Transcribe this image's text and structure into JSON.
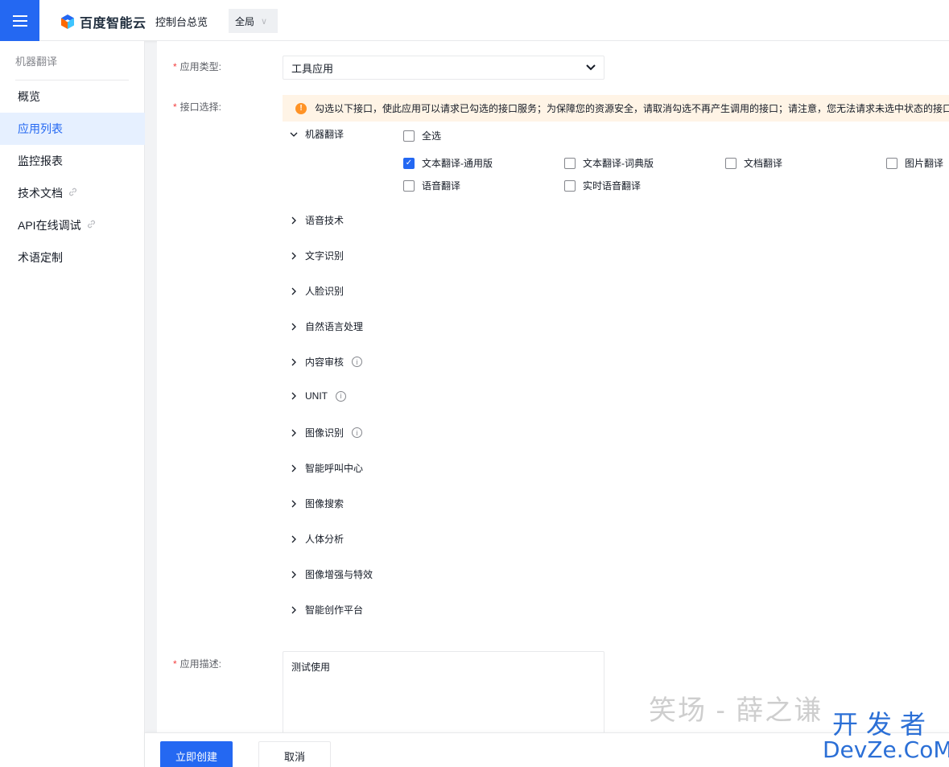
{
  "topbar": {
    "brand": "百度智能云",
    "console": "控制台总览",
    "region": "全局"
  },
  "sidebar": {
    "title": "机器翻译",
    "items": [
      {
        "label": "概览",
        "name": "sidebar-item-overview"
      },
      {
        "label": "应用列表",
        "name": "sidebar-item-app-list",
        "active": true
      },
      {
        "label": "监控报表",
        "name": "sidebar-item-monitor-report"
      },
      {
        "label": "技术文档",
        "name": "sidebar-item-tech-docs",
        "external": true
      },
      {
        "label": "API在线调试",
        "name": "sidebar-item-api-debug",
        "external": true
      },
      {
        "label": "术语定制",
        "name": "sidebar-item-term-custom"
      }
    ]
  },
  "form": {
    "app_type_label": "应用类型:",
    "app_type_value": "工具应用",
    "interface_label": "接口选择:",
    "notice": "勾选以下接口，使此应用可以请求已勾选的接口服务；为保障您的资源安全，请取消勾选不再产生调用的接口；请注意，您无法请求未选中状态的接口服务",
    "expanded_group": "机器翻译",
    "select_all": "全选",
    "apis": [
      {
        "label": "文本翻译-通用版",
        "checked": true
      },
      {
        "label": "文本翻译-词典版",
        "checked": false
      },
      {
        "label": "文档翻译",
        "checked": false
      },
      {
        "label": "图片翻译",
        "checked": false
      },
      {
        "label": "语音翻译",
        "checked": false
      },
      {
        "label": "实时语音翻译",
        "checked": false
      }
    ],
    "groups": [
      {
        "label": "语音技术",
        "info": false
      },
      {
        "label": "文字识别",
        "info": false
      },
      {
        "label": "人脸识别",
        "info": false
      },
      {
        "label": "自然语言处理",
        "info": false
      },
      {
        "label": "内容审核",
        "info": true
      },
      {
        "label": "UNIT",
        "info": true
      },
      {
        "label": "图像识别",
        "info": true
      },
      {
        "label": "智能呼叫中心",
        "info": false
      },
      {
        "label": "图像搜索",
        "info": false
      },
      {
        "label": "人体分析",
        "info": false
      },
      {
        "label": "图像增强与特效",
        "info": false
      },
      {
        "label": "智能创作平台",
        "info": false
      }
    ],
    "desc_label": "应用描述:",
    "desc_value": "测试使用"
  },
  "footer": {
    "create": "立即创建",
    "cancel": "取消"
  },
  "watermarks": {
    "author": "笑场 - 薛之谦",
    "site_cn": "开发者",
    "site_en": "DevZe.CoM"
  },
  "colors": {
    "primary": "#2468f2",
    "warning": "#ff9326",
    "notice_bg": "#fff4e6",
    "required": "#f33e3e"
  }
}
